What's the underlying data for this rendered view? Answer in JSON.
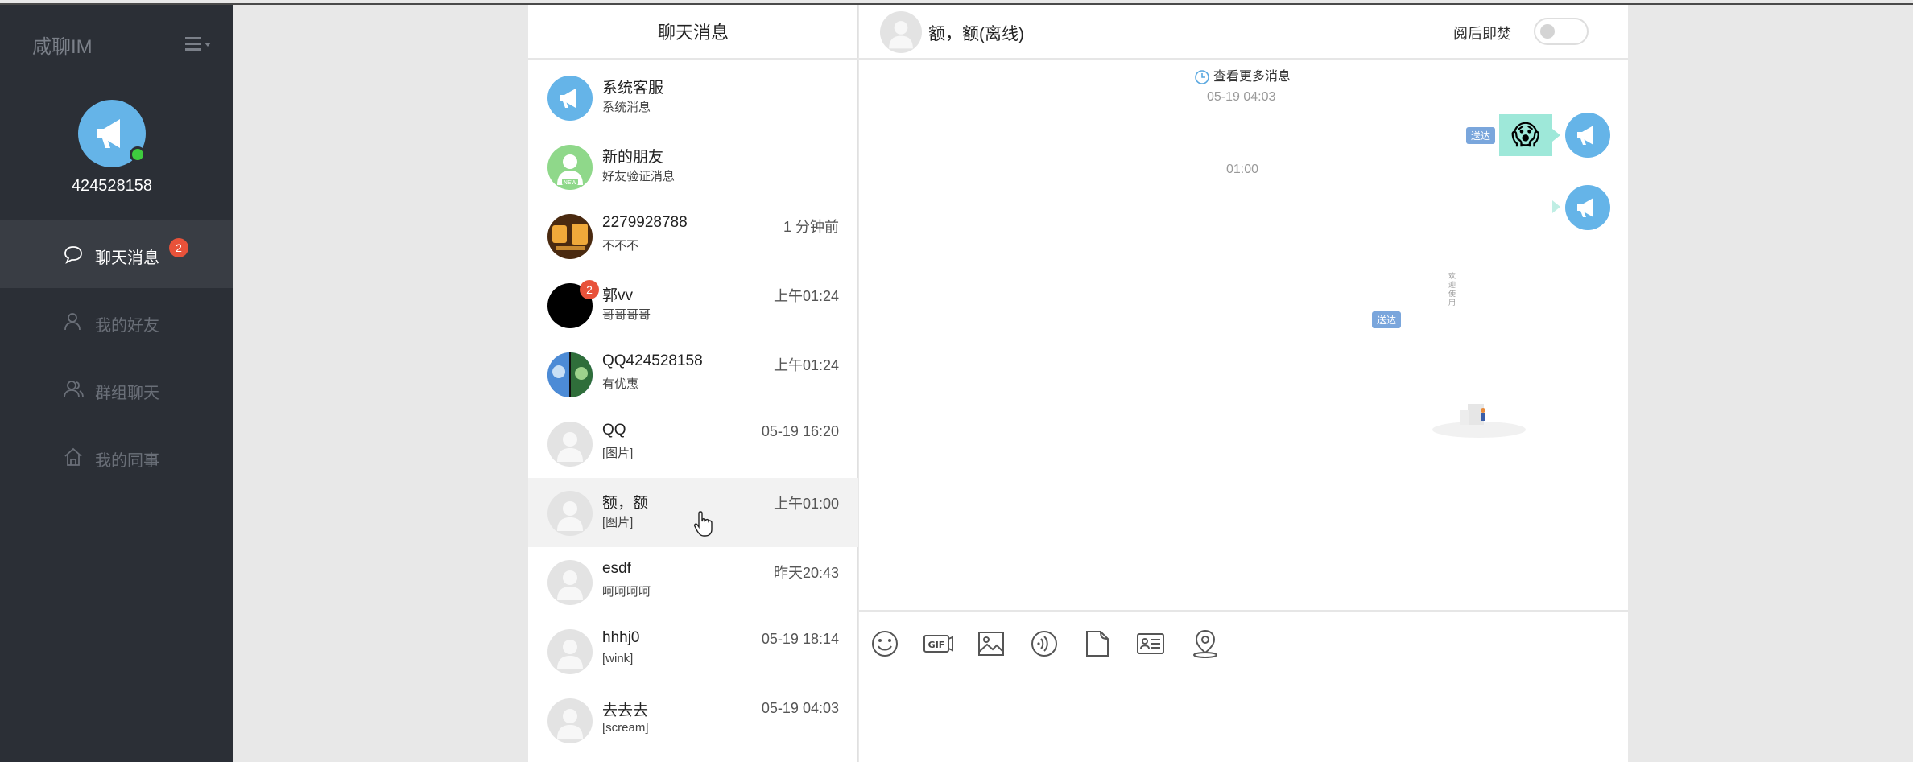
{
  "app": {
    "brand": "咸聊IM",
    "user_id": "424528158"
  },
  "nav": [
    {
      "label": "聊天消息",
      "badge": "2",
      "active": true,
      "icon": "chat-bubble-icon"
    },
    {
      "label": "我的好友",
      "active": false,
      "icon": "person-icon"
    },
    {
      "label": "群组聊天",
      "active": false,
      "icon": "group-icon"
    },
    {
      "label": "我的同事",
      "active": false,
      "icon": "home-icon"
    }
  ],
  "list": {
    "title": "聊天消息",
    "conversations": [
      {
        "name": "系统客服",
        "preview": "系统消息",
        "time": "",
        "avatar": "megaphone-avatar"
      },
      {
        "name": "新的朋友",
        "preview": "好友验证消息",
        "time": "",
        "avatar": "new-friend-avatar"
      },
      {
        "name": "2279928788",
        "preview": "不不不",
        "time": "1 分钟前",
        "avatar": "logo-avatar"
      },
      {
        "name": "郭vv",
        "preview": "哥哥哥哥",
        "time": "上午01:24",
        "avatar": "black-avatar",
        "badge": "2"
      },
      {
        "name": "QQ424528158",
        "preview": "有优惠",
        "time": "上午01:24",
        "avatar": "photo-avatar"
      },
      {
        "name": "QQ",
        "preview": "[图片]",
        "time": "05-19 16:20",
        "avatar": "default-avatar"
      },
      {
        "name": "额，额",
        "preview": "[图片]",
        "time": "上午01:00",
        "avatar": "default-avatar",
        "selected": true
      },
      {
        "name": "esdf",
        "preview": "呵呵呵呵",
        "time": "昨天20:43",
        "avatar": "default-avatar"
      },
      {
        "name": "hhhj0",
        "preview": "[wink]",
        "time": "05-19 18:14",
        "avatar": "default-avatar"
      },
      {
        "name": "去去去",
        "preview": "[scream]",
        "time": "05-19 04:03",
        "avatar": "default-avatar"
      }
    ]
  },
  "chat": {
    "title": "额，额(离线)",
    "burn_after_read_label": "阅后即焚",
    "burn_after_read_on": false,
    "load_more": "查看更多消息",
    "messages": [
      {
        "timestamp": "05-19 04:03",
        "status": "送达",
        "content": "😱"
      },
      {
        "timestamp": "01:00",
        "status": "送达",
        "content": "欢迎使用"
      }
    ]
  },
  "composer": {
    "tools": [
      "emoji-icon",
      "gif-icon",
      "image-icon",
      "voice-icon",
      "file-icon",
      "contact-card-icon",
      "location-icon"
    ],
    "gif_label": "GIF"
  },
  "colors": {
    "sidebar": "#2b2f36",
    "accent": "#65b4e8",
    "badge": "#e8523a",
    "bubble": "#9ee8d9",
    "delivered": "#7aa6dc"
  }
}
